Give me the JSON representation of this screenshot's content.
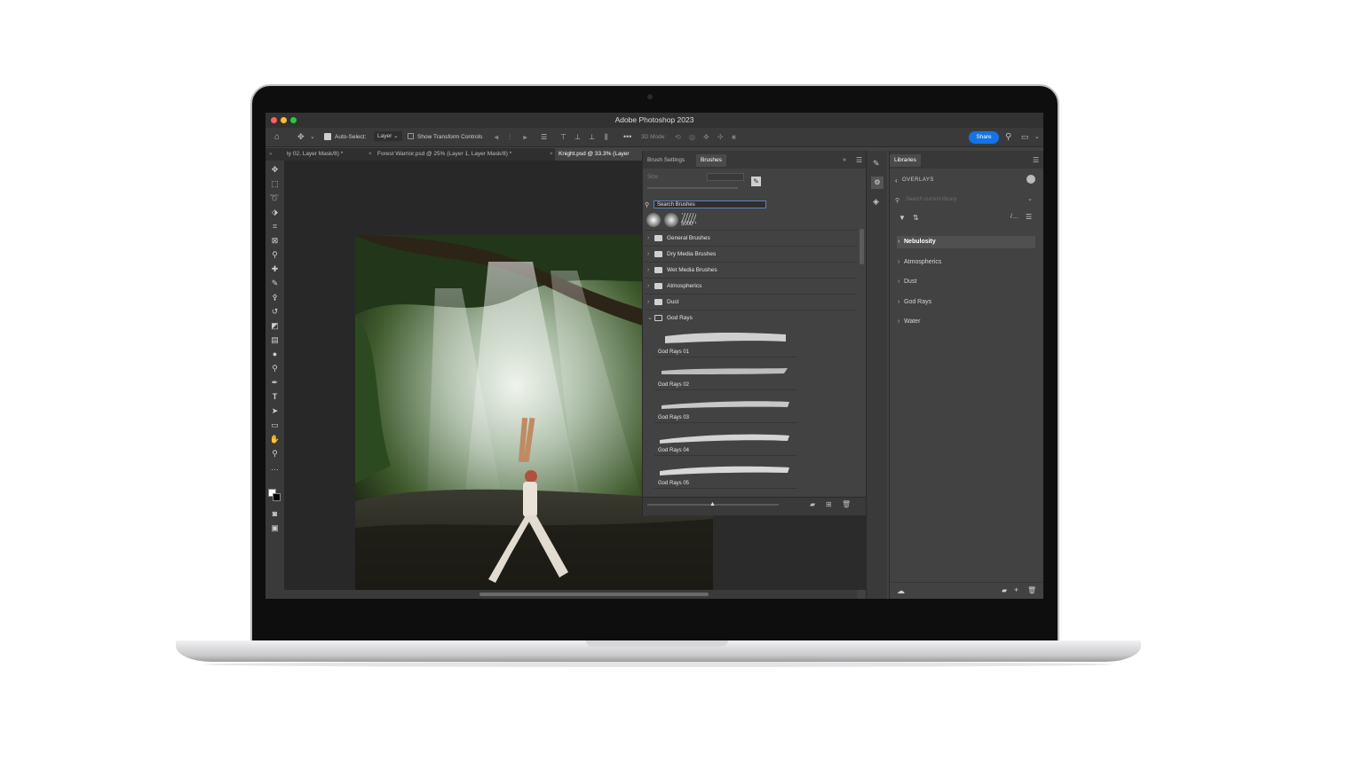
{
  "app": {
    "window_title": "Adobe Photoshop 2023"
  },
  "options_bar": {
    "auto_select_label": "Auto-Select:",
    "auto_select_target": "Layer",
    "show_transform_controls_label": "Show Transform Controls",
    "three_d_mode_label": "3D Mode:",
    "share_label": "Share"
  },
  "document_tabs": [
    {
      "label": "ty 02, Layer Mask/8) *"
    },
    {
      "label": "Forest Warrior.psd @ 25% (Layer 1, Layer Mask/8) *"
    },
    {
      "label": "Knight.psd @ 33.3% (Layer"
    }
  ],
  "brushes_panel": {
    "tabs": [
      "Brush Settings",
      "Brushes"
    ],
    "active_tab": "Brushes",
    "size_label": "Size:",
    "search_placeholder": "Search Brushes",
    "recent_brush_size": "5000",
    "folders": [
      "General Brushes",
      "Dry Media Brushes",
      "Wet Media Brushes",
      "Atmospherics",
      "Dust",
      "God Rays"
    ],
    "brushes": [
      "God Rays 01",
      "God Rays 02",
      "God Rays 03",
      "God Rays 04",
      "God Rays 05"
    ]
  },
  "libraries_panel": {
    "tab": "Libraries",
    "back_label": "OVERLAYS",
    "search_placeholder": "Search current library",
    "groups": [
      "Nebulosity",
      "Atmospherics",
      "Dust",
      "God Rays",
      "Water"
    ],
    "selected_group": "Nebulosity"
  },
  "colors": {
    "accent": "#1473e6",
    "panel_bg": "#424242",
    "canvas_bg": "#282828"
  }
}
